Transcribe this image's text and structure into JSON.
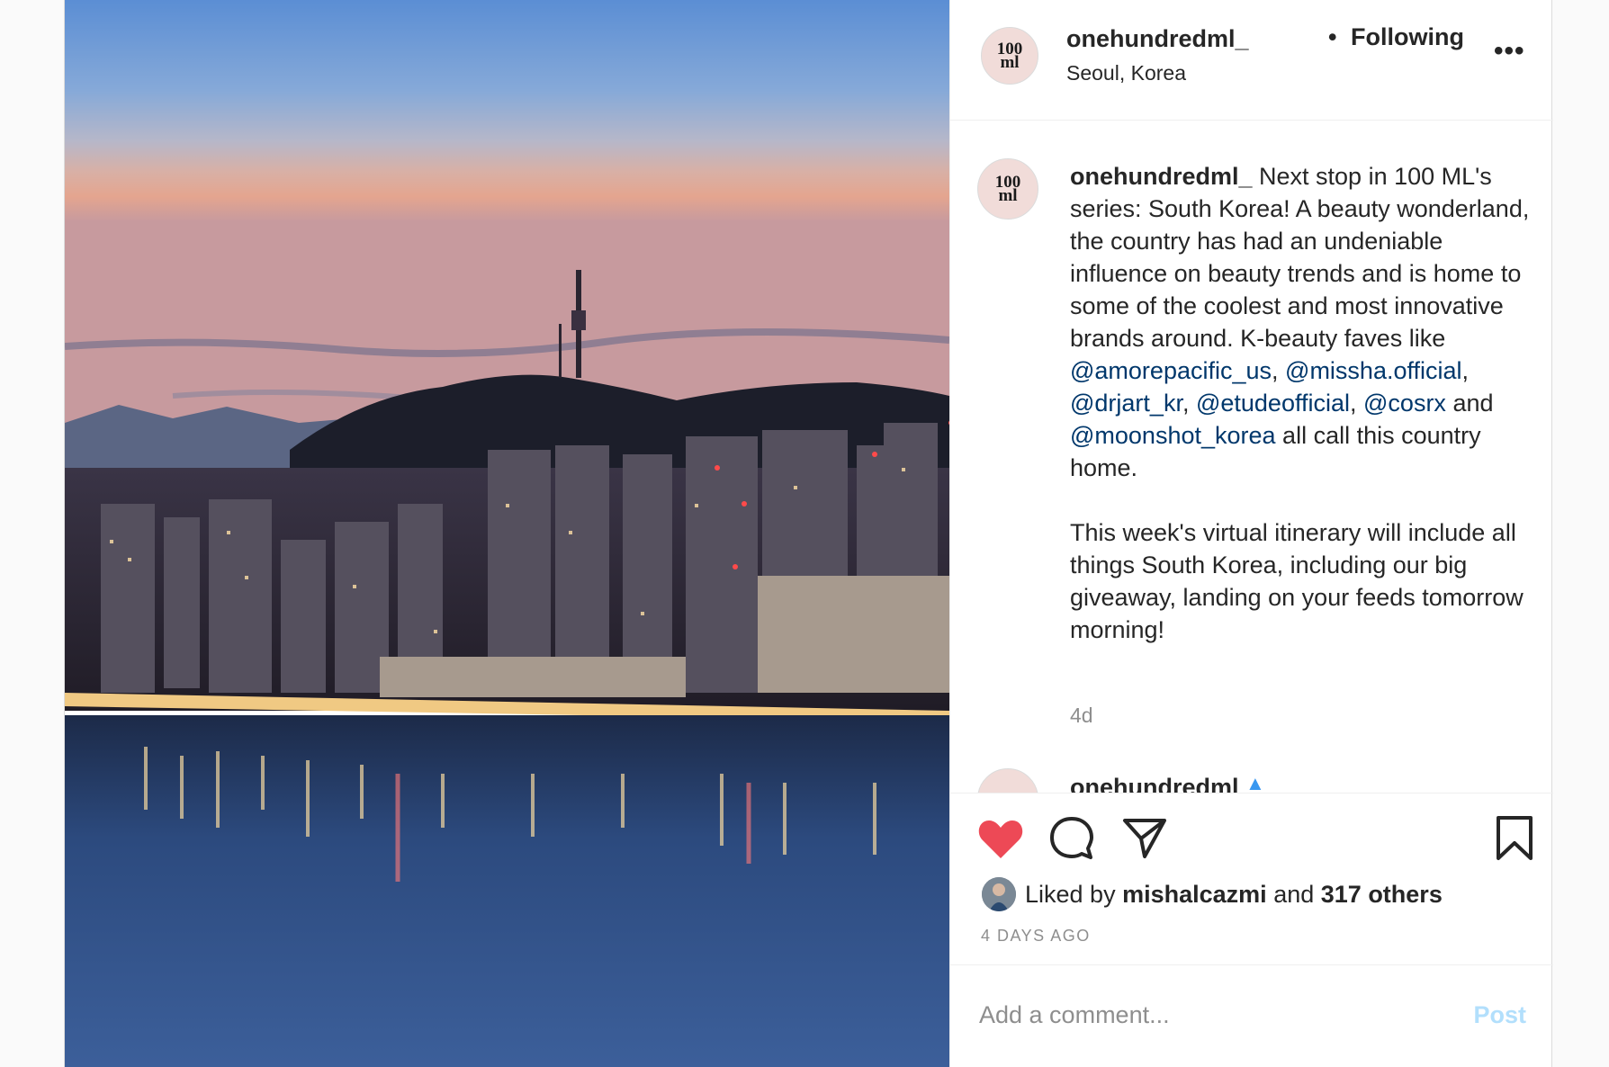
{
  "post": {
    "username": "onehundredml_",
    "avatar_text_top": "100",
    "avatar_text_bottom": "ml",
    "separator": "•",
    "follow_status": "Following",
    "location": "Seoul, Korea",
    "more_label": "•••"
  },
  "caption": {
    "username": "onehundredml_",
    "text_1": " Next stop in 100 ML's series: South Korea! A beauty wonderland, the country has had an undeniable influence on beauty trends and is home to some of the coolest and most innovative brands around. K-beauty faves like ",
    "mention_1": "@amorepacific_us",
    "sep_1": ", ",
    "mention_2": "@missha.official",
    "sep_2": ", ",
    "mention_3": "@drjart_kr",
    "sep_3": ", ",
    "mention_4": "@etudeofficial",
    "sep_4": ", ",
    "mention_5": "@cosrx",
    "sep_5": " and ",
    "mention_6": "@moonshot_korea",
    "text_2": " all call this country home.\n\nThis week's virtual itinerary will include all things South Korea, including our big giveaway, landing on your feeds tomorrow morning!",
    "age": "4d"
  },
  "next_comment": {
    "username": "onehundredml_"
  },
  "actions": {
    "liked_prefix": "Liked by ",
    "liked_user": "mishalcazmi",
    "liked_mid": " and ",
    "liked_others": "317 others",
    "timestamp": "4 DAYS AGO",
    "heart_color": "#ed4956"
  },
  "comment_box": {
    "placeholder": "Add a comment...",
    "post_label": "Post"
  }
}
